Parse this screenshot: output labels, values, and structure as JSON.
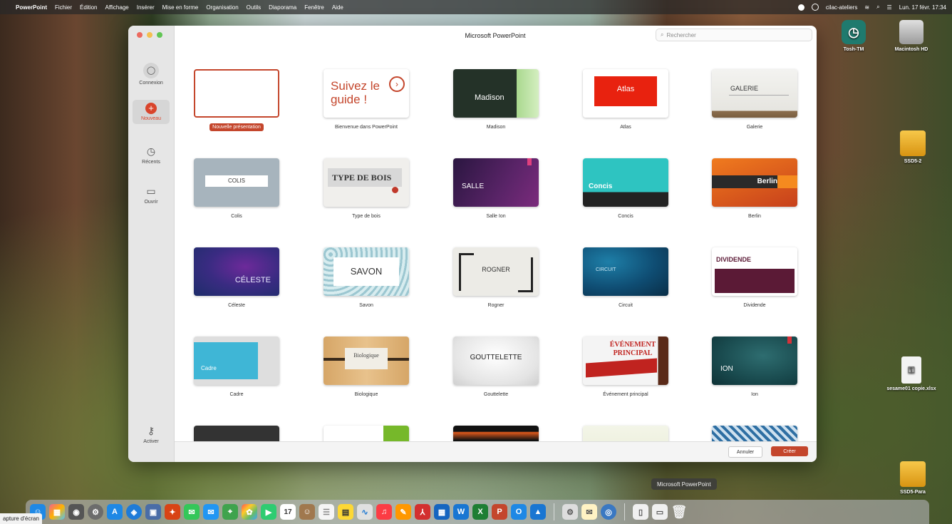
{
  "menubar": {
    "app": "PowerPoint",
    "items": [
      "Fichier",
      "Édition",
      "Affichage",
      "Insérer",
      "Mise en forme",
      "Organisation",
      "Outils",
      "Diaporama",
      "Fenêtre",
      "Aide"
    ],
    "user": "cilac-ateliers",
    "datetime": "Lun. 17 févr. 17:34"
  },
  "window": {
    "title": "Microsoft PowerPoint",
    "search_placeholder": "Rechercher"
  },
  "sidebar": {
    "connexion": "Connexion",
    "nouveau": "Nouveau",
    "recents": "Récents",
    "ouvrir": "Ouvrir",
    "activer": "Activer"
  },
  "templates": [
    {
      "name": "Nouvelle présentation",
      "thumb_text": ""
    },
    {
      "name": "Bienvenue dans PowerPoint",
      "thumb_text": "Suivez le guide !"
    },
    {
      "name": "Madison",
      "thumb_text": "Madison"
    },
    {
      "name": "Atlas",
      "thumb_text": "Atlas"
    },
    {
      "name": "Galerie",
      "thumb_text": "GALERIE"
    },
    {
      "name": "Colis",
      "thumb_text": "COLIS"
    },
    {
      "name": "Type de bois",
      "thumb_text": "TYPE DE BOIS"
    },
    {
      "name": "Salle Ion",
      "thumb_text": "SALLE"
    },
    {
      "name": "Concis",
      "thumb_text": "Concis"
    },
    {
      "name": "Berlin",
      "thumb_text": "Berlin"
    },
    {
      "name": "Céleste",
      "thumb_text": "CÉLESTE"
    },
    {
      "name": "Savon",
      "thumb_text": "SAVON"
    },
    {
      "name": "Rogner",
      "thumb_text": "ROGNER"
    },
    {
      "name": "Circuit",
      "thumb_text": "CIRCUIT"
    },
    {
      "name": "Dividende",
      "thumb_text": "DIVIDENDE"
    },
    {
      "name": "Cadre",
      "thumb_text": "Cadre"
    },
    {
      "name": "Biologique",
      "thumb_text": "Biologique"
    },
    {
      "name": "Gouttelette",
      "thumb_text": "GOUTTELETTE"
    },
    {
      "name": "Événement principal",
      "thumb_text": "ÉVÉNEMENT PRINCIPAL"
    },
    {
      "name": "Ion",
      "thumb_text": "ION"
    }
  ],
  "footer": {
    "cancel": "Annuler",
    "create": "Créer"
  },
  "desktop": {
    "tosh": "Tosh-TM",
    "mac": "Macintosh HD",
    "ssd2": "SSD5-2",
    "file": "sesame01 copie.xlsx",
    "ssdpara": "SSD5-Para"
  },
  "dock": {
    "tooltip": "Microsoft PowerPoint",
    "capture": "apture d'écran",
    "calendar_day": "17"
  }
}
